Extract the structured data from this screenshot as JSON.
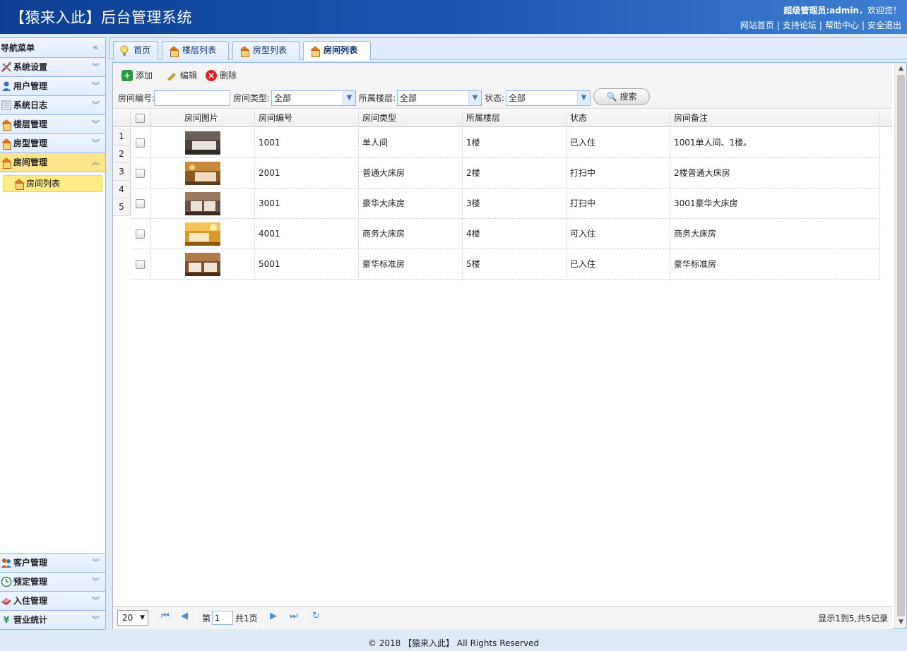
{
  "header": {
    "title": "【猿来入此】后台管理系统",
    "welcome_user": "超级管理员:admin",
    "welcome_suffix": "，欢迎您！",
    "links": [
      "网站首页",
      "支持论坛",
      "帮助中心",
      "安全退出"
    ],
    "link_sep": "|"
  },
  "sidebar": {
    "title": "导航菜单",
    "collapse_icon": "«",
    "top_items": [
      {
        "label": "系统设置",
        "icon": "tools-icon"
      },
      {
        "label": "用户管理",
        "icon": "user-icon"
      },
      {
        "label": "系统日志",
        "icon": "log-icon"
      },
      {
        "label": "楼层管理",
        "icon": "house-icon"
      },
      {
        "label": "房型管理",
        "icon": "house-icon"
      },
      {
        "label": "房间管理",
        "icon": "house-icon"
      }
    ],
    "active_sub": "房间列表",
    "bottom_items": [
      {
        "label": "客户管理",
        "icon": "customer-icon"
      },
      {
        "label": "预定管理",
        "icon": "clock-icon"
      },
      {
        "label": "入住管理",
        "icon": "checkin-icon"
      },
      {
        "label": "营业统计",
        "icon": "yen-icon"
      }
    ]
  },
  "tabs": [
    {
      "label": "首页",
      "closable": false
    },
    {
      "label": "楼层列表",
      "closable": true
    },
    {
      "label": "房型列表",
      "closable": true
    },
    {
      "label": "房间列表",
      "closable": true,
      "active": true
    }
  ],
  "tab_close": "×",
  "toolbar": {
    "add": "添加",
    "edit": "编辑",
    "delete": "删除"
  },
  "filters": {
    "room_no_label": "房间编号:",
    "room_no_value": "",
    "room_type_label": "房间类型:",
    "room_type_value": "全部",
    "floor_label": "所属楼层:",
    "floor_value": "全部",
    "status_label": "状态:",
    "status_value": "全部",
    "search_button": "搜索"
  },
  "table": {
    "columns": [
      "房间图片",
      "房间编号",
      "房间类型",
      "所属楼层",
      "状态",
      "房间备注"
    ],
    "row_numbers": [
      "1",
      "2",
      "3",
      "4",
      "5"
    ],
    "rows": [
      {
        "no": "1001",
        "type": "单人间",
        "floor": "1楼",
        "status": "已入住",
        "note": "1001单人间、1楼。"
      },
      {
        "no": "2001",
        "type": "普通大床房",
        "floor": "2楼",
        "status": "打扫中",
        "note": "2楼普通大床房"
      },
      {
        "no": "3001",
        "type": "豪华大床房",
        "floor": "3楼",
        "status": "打扫中",
        "note": "3001豪华大床房"
      },
      {
        "no": "4001",
        "type": "商务大床房",
        "floor": "4楼",
        "status": "可入住",
        "note": "商务大床房"
      },
      {
        "no": "5001",
        "type": "豪华标准房",
        "floor": "5楼",
        "status": "已入住",
        "note": "豪华标准房"
      }
    ]
  },
  "pager": {
    "page_size": "20",
    "page_prefix": "第",
    "page_value": "1",
    "page_suffix": "共1页",
    "info": "显示1到5,共5记录"
  },
  "footer": "© 2018 【猿来入此】 All Rights Reserved",
  "colors": {
    "header_blue": "#1955b3",
    "active_yellow": "#fbe489",
    "border_blue": "#95b8e7"
  }
}
